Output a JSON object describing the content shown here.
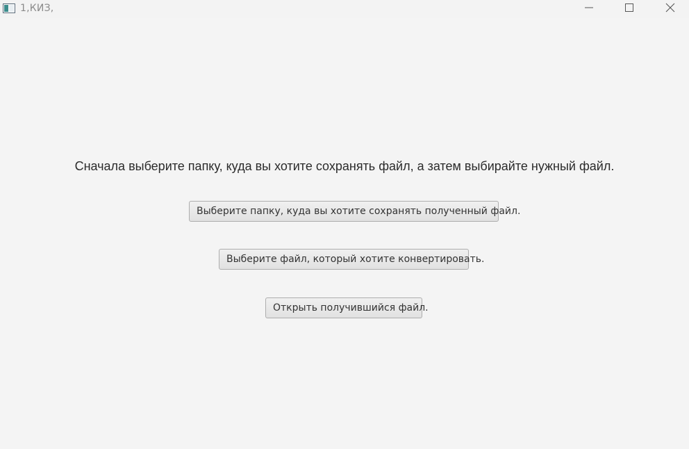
{
  "window": {
    "title": "1,КИЗ,",
    "icons": {
      "app": "app-window-icon",
      "minimize": "minimize-icon",
      "maximize": "maximize-icon",
      "close": "close-icon"
    }
  },
  "main": {
    "instruction": "Сначала выберите папку, куда вы хотите сохранять файл, а затем выбирайте нужный файл.",
    "buttons": {
      "choose_folder": "Выберите папку, куда вы хотите сохранять полученный файл.",
      "choose_file": "Выберите файл, который хотите конвертировать.",
      "open_result": "Открыть получившийся файл."
    }
  }
}
